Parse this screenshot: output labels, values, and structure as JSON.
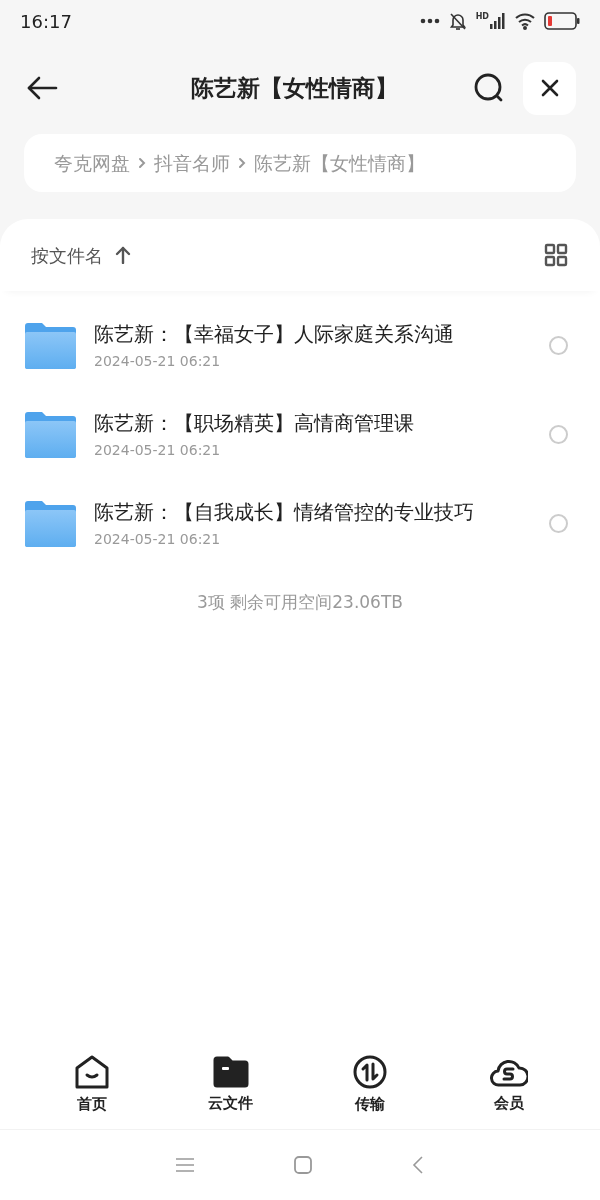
{
  "status_bar": {
    "time": "16:17",
    "signal_label": "HD"
  },
  "header": {
    "title": "陈艺新【女性情商】"
  },
  "breadcrumb": [
    "夸克网盘",
    "抖音名师",
    "陈艺新【女性情商】"
  ],
  "sort": {
    "label": "按文件名"
  },
  "files": [
    {
      "name": "陈艺新：【幸福女子】人际家庭关系沟通",
      "date": "2024-05-21 06:21",
      "checked": false
    },
    {
      "name": "陈艺新：【职场精英】高情商管理课",
      "date": "2024-05-21 06:21",
      "checked": false
    },
    {
      "name": "陈艺新：【自我成长】情绪管控的专业技巧",
      "date": "2024-05-21 06:21",
      "checked": false
    }
  ],
  "summary": "3项 剩余可用空间23.06TB",
  "tabs": [
    {
      "kind": "home",
      "label": "首页",
      "selected": false
    },
    {
      "kind": "files",
      "label": "云文件",
      "selected": true
    },
    {
      "kind": "transfer",
      "label": "传输",
      "selected": false
    },
    {
      "kind": "member",
      "label": "会员",
      "selected": false
    }
  ]
}
